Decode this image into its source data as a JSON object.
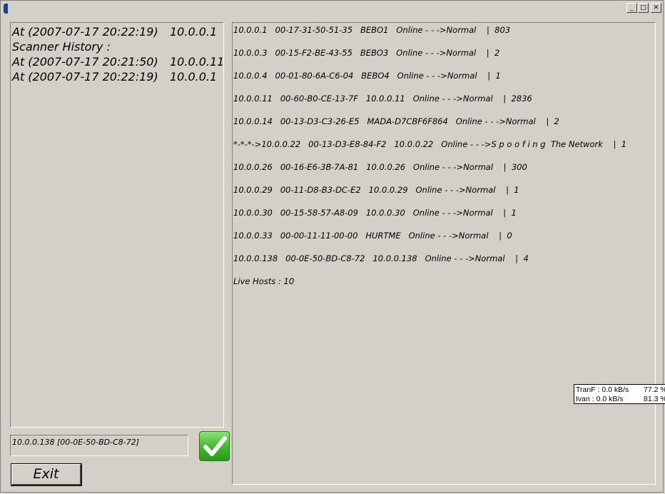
{
  "window": {
    "title": "",
    "buttons": {
      "minimize": "_",
      "maximize": "□",
      "close": "✕"
    }
  },
  "history": {
    "rows": [
      {
        "timestamp": "At (2007-07-17 20:22:19)",
        "ip": "10.0.0.1"
      },
      {
        "timestamp": "Scanner History :",
        "ip": ""
      },
      {
        "timestamp": "At (2007-07-17 20:21:50)",
        "ip": "10.0.0.11"
      },
      {
        "timestamp": "At (2007-07-17 20:22:19)",
        "ip": "10.0.0.1"
      }
    ]
  },
  "selected_host": "10.0.0.138 [00-0E-50-BD-C8-72]",
  "confirm_icon": "check-icon",
  "exit_label": "Exit",
  "results": {
    "rows": [
      "10.0.0.1   00-17-31-50-51-35   BEBO1   Online - - ->Normal    |  803",
      "10.0.0.3   00-15-F2-BE-43-55   BEBO3   Online - - ->Normal    |  2",
      "10.0.0.4   00-01-80-6A-C6-04   BEBO4   Online - - ->Normal    |  1",
      "10.0.0.11   00-60-B0-CE-13-7F   10.0.0.11   Online - - ->Normal    |  2836",
      "10.0.0.14   00-13-D3-C3-26-E5   MADA-D7CBF6F864   Online - - ->Normal    |  2",
      "*-*-*->10.0.0.22   00-13-D3-E8-84-F2   10.0.0.22   Online - - ->S p o o f i n g  The Network    |  1",
      "10.0.0.26   00-16-E6-3B-7A-81   10.0.0.26   Online - - ->Normal    |  300",
      "10.0.0.29   00-11-D8-B3-DC-E2   10.0.0.29   Online - - ->Normal    |  1",
      "10.0.0.30   00-15-58-57-A8-09   10.0.0.30   Online - - ->Normal    |  1",
      "10.0.0.33   00-00-11-11-00-00   HURTME   Online - - ->Normal    |  0",
      "10.0.0.138   00-0E-50-BD-C8-72   10.0.0.138   Online - - ->Normal    |  4"
    ],
    "summary": "Live Hosts : 10"
  },
  "net_monitor": {
    "rows": [
      {
        "label": "TranF  : 0.0 kB/s",
        "pct": "77.2 %"
      },
      {
        "label": "Ivan   : 0.0 kB/s",
        "pct": "81.3 %"
      }
    ]
  }
}
